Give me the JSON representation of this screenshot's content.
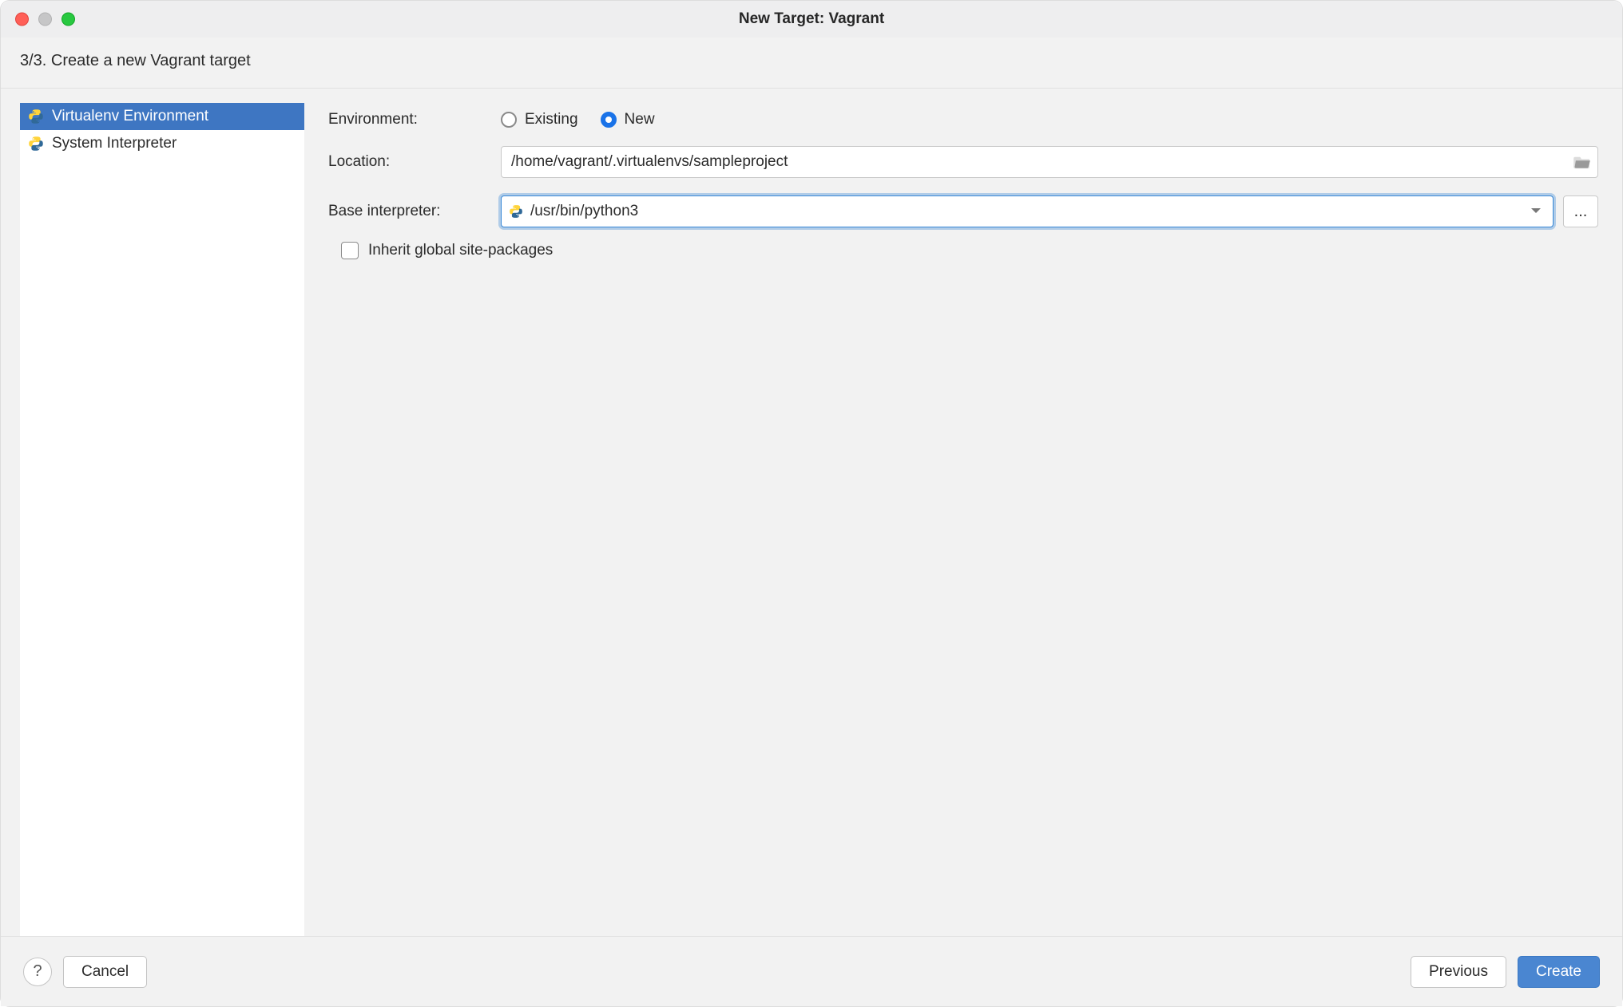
{
  "window": {
    "title": "New Target: Vagrant"
  },
  "step": {
    "text": "3/3. Create a new Vagrant target"
  },
  "sidebar": {
    "items": [
      {
        "label": "Virtualenv Environment",
        "selected": true
      },
      {
        "label": "System Interpreter",
        "selected": false
      }
    ]
  },
  "form": {
    "environment_label": "Environment:",
    "radio_existing": "Existing",
    "radio_new": "New",
    "radio_selected": "new",
    "location_label": "Location:",
    "location_value": "/home/vagrant/.virtualenvs/sampleproject",
    "base_interpreter_label": "Base interpreter:",
    "base_interpreter_value": "/usr/bin/python3",
    "ellipsis": "...",
    "inherit_label": "Inherit global site-packages",
    "inherit_checked": false
  },
  "footer": {
    "help": "?",
    "cancel": "Cancel",
    "previous": "Previous",
    "create": "Create"
  }
}
